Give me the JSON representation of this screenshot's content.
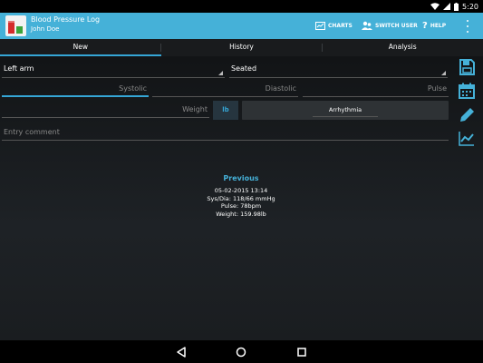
{
  "status_bar": {
    "time": "5:20"
  },
  "app_bar": {
    "title": "Blood Pressure Log",
    "subtitle": "John Doe",
    "actions": [
      {
        "label": "CHARTS",
        "icon": "chart-icon"
      },
      {
        "label": "SWITCH USER",
        "icon": "switch-user-icon"
      },
      {
        "label": "HELP",
        "icon": "help-icon"
      }
    ]
  },
  "tabs": [
    {
      "label": "New",
      "active": true
    },
    {
      "label": "History",
      "active": false
    },
    {
      "label": "Analysis",
      "active": false
    }
  ],
  "form": {
    "arm_value": "Left arm",
    "position_value": "Seated",
    "systolic_placeholder": "Systolic",
    "diastolic_placeholder": "Diastolic",
    "pulse_placeholder": "Pulse",
    "weight_placeholder": "Weight",
    "unit_label": "lb",
    "arrhythmia_label": "Arrhythmia",
    "comment_placeholder": "Entry comment"
  },
  "side_actions": [
    "save-icon",
    "calendar-icon",
    "edit-icon",
    "trend-chart-icon"
  ],
  "previous": {
    "title": "Previous",
    "datetime": "05-02-2015 13:14",
    "sys_dia": "Sys/Dia: 118/66 mmHg",
    "pulse": "Pulse: 78bpm",
    "weight": "Weight: 159.98lb"
  },
  "colors": {
    "accent": "#45b1d8",
    "tab_indicator": "#35a6d6",
    "background": "#1a1d20"
  }
}
